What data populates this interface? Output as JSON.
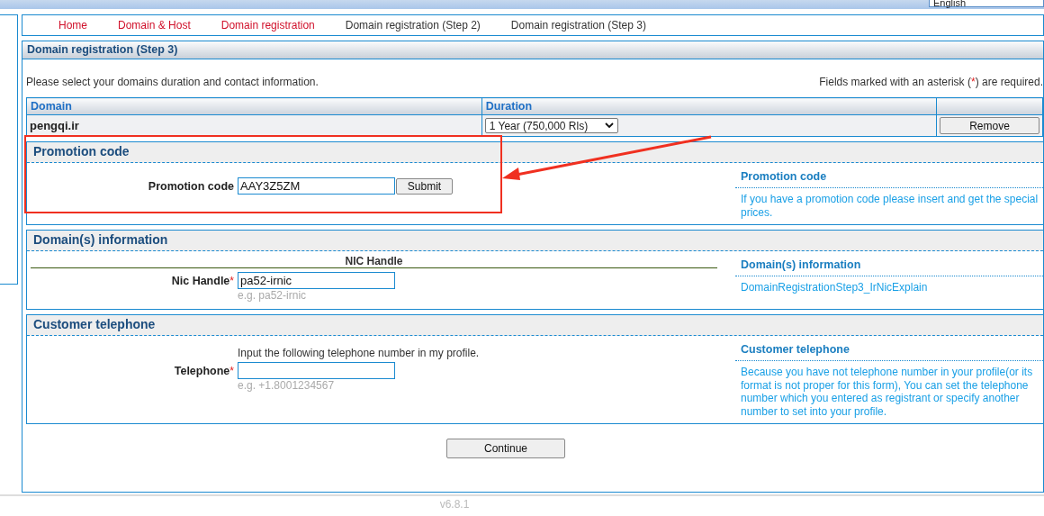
{
  "language": {
    "value": "English"
  },
  "nav": [
    {
      "label": "Home",
      "kind": "link"
    },
    {
      "label": "Domain & Host",
      "kind": "link"
    },
    {
      "label": "Domain registration",
      "kind": "link"
    },
    {
      "label": "Domain registration (Step 2)",
      "kind": "text"
    },
    {
      "label": "Domain registration (Step 3)",
      "kind": "text"
    }
  ],
  "panel": {
    "title": "Domain registration (Step 3)",
    "intro": "Please select your domains duration and contact information.",
    "required_note": {
      "before": "Fields marked with an asterisk (",
      "mark": "*",
      "after": ") are required."
    },
    "table": {
      "columns": [
        "Domain",
        "Duration"
      ],
      "rows": [
        {
          "domain": "pengqi.ir",
          "duration": "1 Year (750,000 Rls)",
          "action": "Remove"
        }
      ]
    },
    "sections": [
      {
        "title": "Promotion code",
        "field": {
          "label": "Promotion code",
          "required": false,
          "value": "AAY3Z5ZM",
          "button": "Submit"
        },
        "help": {
          "title": "Promotion code",
          "text": "If you have a promotion code please insert and get the special prices."
        }
      },
      {
        "title": "Domain(s) information",
        "subheading": "NIC Handle",
        "field": {
          "label": "Nic Handle",
          "required": true,
          "value": "pa52-irnic",
          "hint": "e.g. pa52-irnic"
        },
        "help": {
          "title": "Domain(s) information",
          "text": "DomainRegistrationStep3_IrNicExplain"
        }
      },
      {
        "title": "Customer telephone",
        "note": "Input the following telephone number in my profile.",
        "field": {
          "label": "Telephone",
          "required": true,
          "hint": "e.g. +1.8001234567"
        },
        "help": {
          "title": "Customer telephone",
          "text": "Because you have not telephone number in your profile(or its format is not proper for this form), You can set the telephone number which you entered as registrant or specify another number to set into your profile."
        }
      }
    ],
    "continue": "Continue"
  },
  "version": "v6.8.1",
  "annotations": {
    "highlight_box": true,
    "arrow": true
  }
}
